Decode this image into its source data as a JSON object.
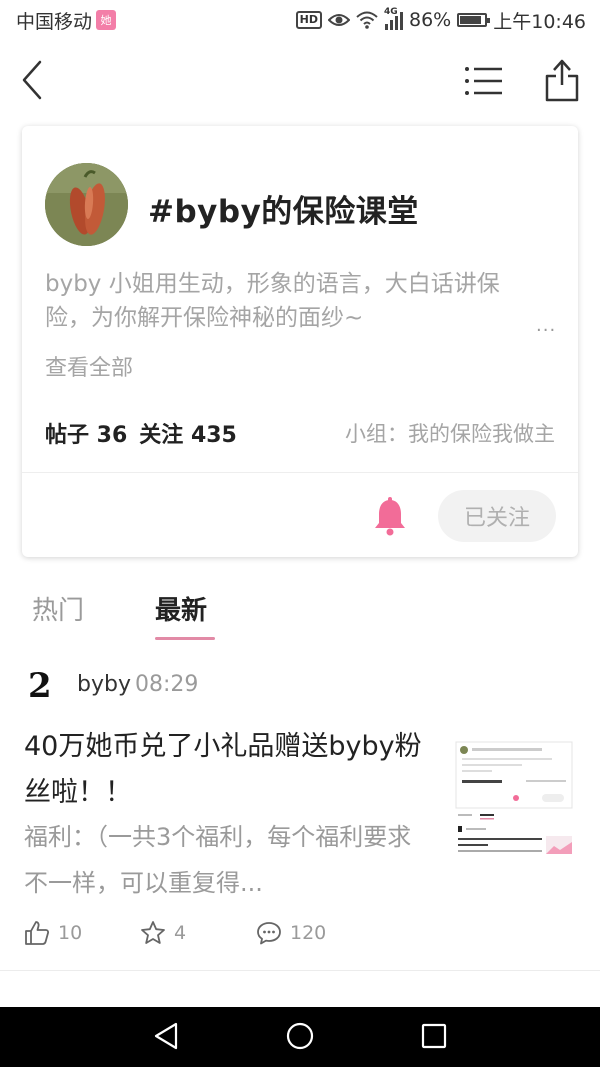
{
  "status_bar": {
    "carrier": "中国移动",
    "carrier_badge": "她",
    "hd": "HD",
    "network": "4G",
    "battery_percent": "86%",
    "battery_level": 0.86,
    "time": "上午10:46"
  },
  "topic": {
    "title": "#byby的保险课堂",
    "description": "byby 小姐用生动，形象的语言，大白话讲保险，为你解开保险神秘的面纱~",
    "more": "···",
    "view_all": "查看全部",
    "stats": {
      "posts": "帖子 36",
      "followers": "关注 435"
    },
    "group": "小组：我的保险我做主",
    "follow_button": "已关注"
  },
  "tabs": [
    {
      "label": "热门",
      "active": false
    },
    {
      "label": "最新",
      "active": true
    }
  ],
  "post": {
    "avatar_text": "2",
    "user": "byby",
    "time": "08:29",
    "title": "40万她币兑了小礼品赠送byby粉丝啦！！",
    "excerpt": "福利：（一共3个福利，每个福利要求不一样，可以重复得...",
    "likes": "10",
    "favorites": "4",
    "comments": "120"
  },
  "colors": {
    "accent": "#f26c98",
    "tab_underline": "#e28aa6",
    "muted_text": "#a5a5a5"
  }
}
